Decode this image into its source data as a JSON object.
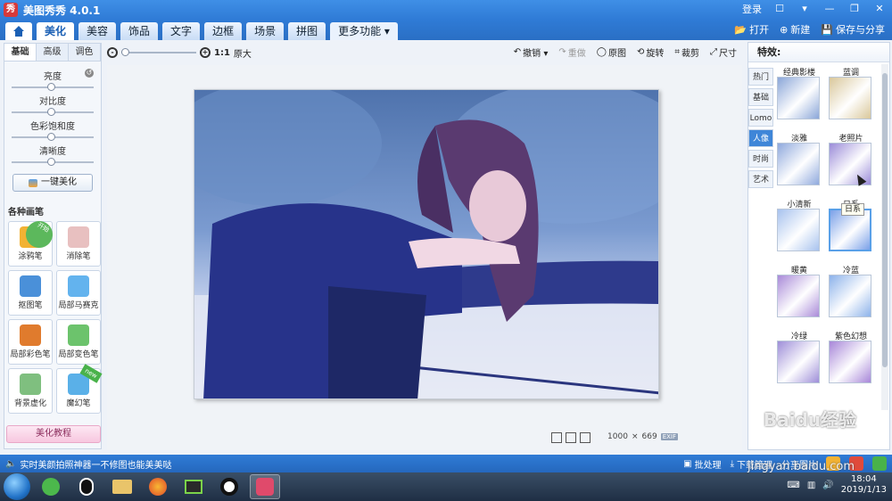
{
  "window": {
    "logo_text": "秀",
    "title": "美图秀秀 4.0.1",
    "login_label": "登录"
  },
  "tabs": [
    {
      "label": "美化",
      "active": true
    },
    {
      "label": "美容"
    },
    {
      "label": "饰品"
    },
    {
      "label": "文字"
    },
    {
      "label": "边框"
    },
    {
      "label": "场景"
    },
    {
      "label": "拼图"
    },
    {
      "label": "更多功能 ▾"
    }
  ],
  "tabbar_actions": {
    "open": "打开",
    "new": "新建",
    "save_share": "保存与分享"
  },
  "left_panel": {
    "subtabs": [
      "基础",
      "高级",
      "调色"
    ],
    "sliders": [
      {
        "label": "亮度",
        "value": 0.5
      },
      {
        "label": "对比度",
        "value": 0.5
      },
      {
        "label": "色彩饱和度",
        "value": 0.5
      },
      {
        "label": "清晰度",
        "value": 0.5
      }
    ],
    "one_click_label": "一键美化",
    "brushes_title": "各种画笔",
    "brushes": [
      {
        "label": "涂鸦笔",
        "badge": "开始",
        "color": "#f2b233"
      },
      {
        "label": "消除笔",
        "badge": "",
        "color": "#e8c0c0"
      },
      {
        "label": "抠图笔",
        "badge": "",
        "color": "#4a90d9"
      },
      {
        "label": "局部马赛克",
        "badge": "",
        "color": "#63b3ee"
      },
      {
        "label": "局部彩色笔",
        "badge": "",
        "color": "#e07b2d"
      },
      {
        "label": "局部变色笔",
        "badge": "",
        "color": "#6cc36c"
      },
      {
        "label": "背景虚化",
        "badge": "",
        "color": "#7fbf7f"
      },
      {
        "label": "魔幻笔",
        "badge": "new",
        "color": "#5ab0e8"
      }
    ],
    "tutorial_label": "美化教程"
  },
  "canvas_toolbar": {
    "ratio_label": "1:1",
    "original_size_label": "原大",
    "tools": [
      {
        "label": "撤销 ▾",
        "disabled": false
      },
      {
        "label": "重做",
        "disabled": true
      },
      {
        "label": "原图",
        "disabled": false
      },
      {
        "label": "旋转",
        "disabled": false
      },
      {
        "label": "裁剪",
        "disabled": false
      },
      {
        "label": "尺寸",
        "disabled": false
      }
    ]
  },
  "image_info": {
    "width": "1000",
    "times": "×",
    "height": "669",
    "exif": "EXIF"
  },
  "right_panel": {
    "title": "特效:",
    "categories": [
      {
        "label": "热门"
      },
      {
        "label": "基础"
      },
      {
        "label": "Lomo"
      },
      {
        "label": "人像",
        "active": true
      },
      {
        "label": "时尚"
      },
      {
        "label": "艺术"
      }
    ],
    "effects": [
      {
        "label": "经典影楼",
        "tint": "#8aa6d8"
      },
      {
        "label": "蓝调",
        "tint": "#d9c79a"
      },
      {
        "label": "淡雅",
        "tint": "#8fa9dd"
      },
      {
        "label": "老照片",
        "tint": "#9a8bd8"
      },
      {
        "label": "小清新",
        "tint": "#a7c2ee"
      },
      {
        "label": "日系",
        "tint": "#7aa0e8"
      },
      {
        "label": "暖黄",
        "tint": "#a98ad8"
      },
      {
        "label": "冷蓝",
        "tint": "#8cb2ea"
      },
      {
        "label": "冷绿",
        "tint": "#9e8ed8"
      },
      {
        "label": "紫色幻想",
        "tint": "#a786d8"
      },
      {
        "label": "冷紫",
        "tint": "#b3a2e0"
      }
    ],
    "tooltip": "日系"
  },
  "statusbar": {
    "promo": "实时美颜拍照神器一不修图也能美美哒",
    "batch": "批处理",
    "download_manager": "下载管理",
    "share_image": "分享图片"
  },
  "taskbar": {
    "time": "18:04",
    "date": "2019/1/13"
  },
  "watermark": {
    "main": "Baidu经验",
    "sub": "jingyan.baidu.com"
  }
}
